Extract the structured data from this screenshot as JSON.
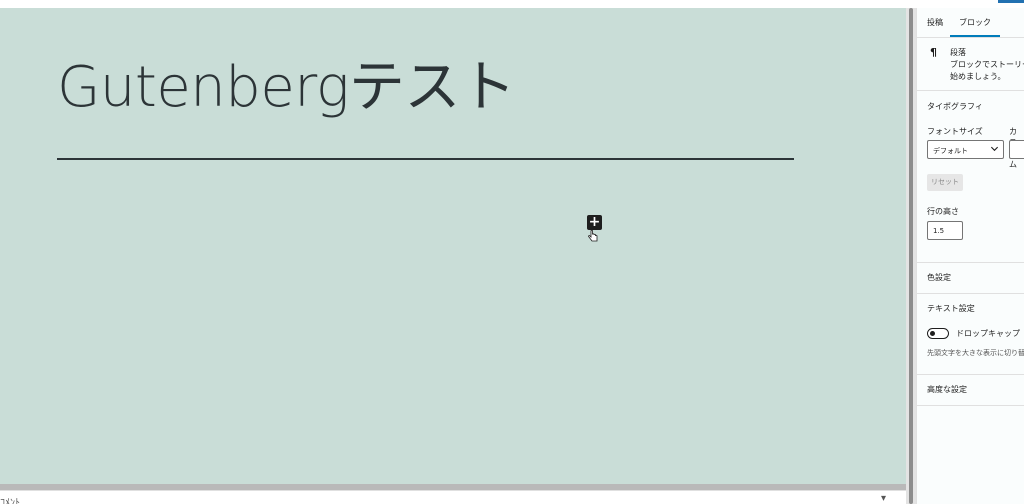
{
  "editor": {
    "post_title": "Gutenbergテスト",
    "inserter_symbol": "+",
    "bottom_bar_label": "ｺﾒﾝﾄ",
    "bottom_bar_caret": "▾"
  },
  "sidebar": {
    "tabs": [
      {
        "label": "投稿",
        "active": false
      },
      {
        "label": "ブロック",
        "active": true
      }
    ],
    "block": {
      "icon": "¶",
      "name": "段落",
      "description": "ブロックでストーリーを始めましょう。"
    },
    "typography": {
      "title": "タイポグラフィ",
      "font_size_label": "フォントサイズ",
      "custom_label": "カスタム",
      "font_size_value": "デフォルト",
      "reset_label": "リセット",
      "line_height_label": "行の高さ",
      "line_height_value": "1.5"
    },
    "color_title": "色設定",
    "text_settings": {
      "title": "テキスト設定",
      "drop_cap_label": "ドロップキャップ",
      "drop_cap_enabled": false,
      "drop_cap_help": "先頭文字を大きな表示に切り替えます。"
    },
    "advanced_title": "高度な設定"
  },
  "colors": {
    "canvas_bg": "#c9ddd7",
    "accent": "#007cba",
    "title_text": "#2c3437"
  }
}
